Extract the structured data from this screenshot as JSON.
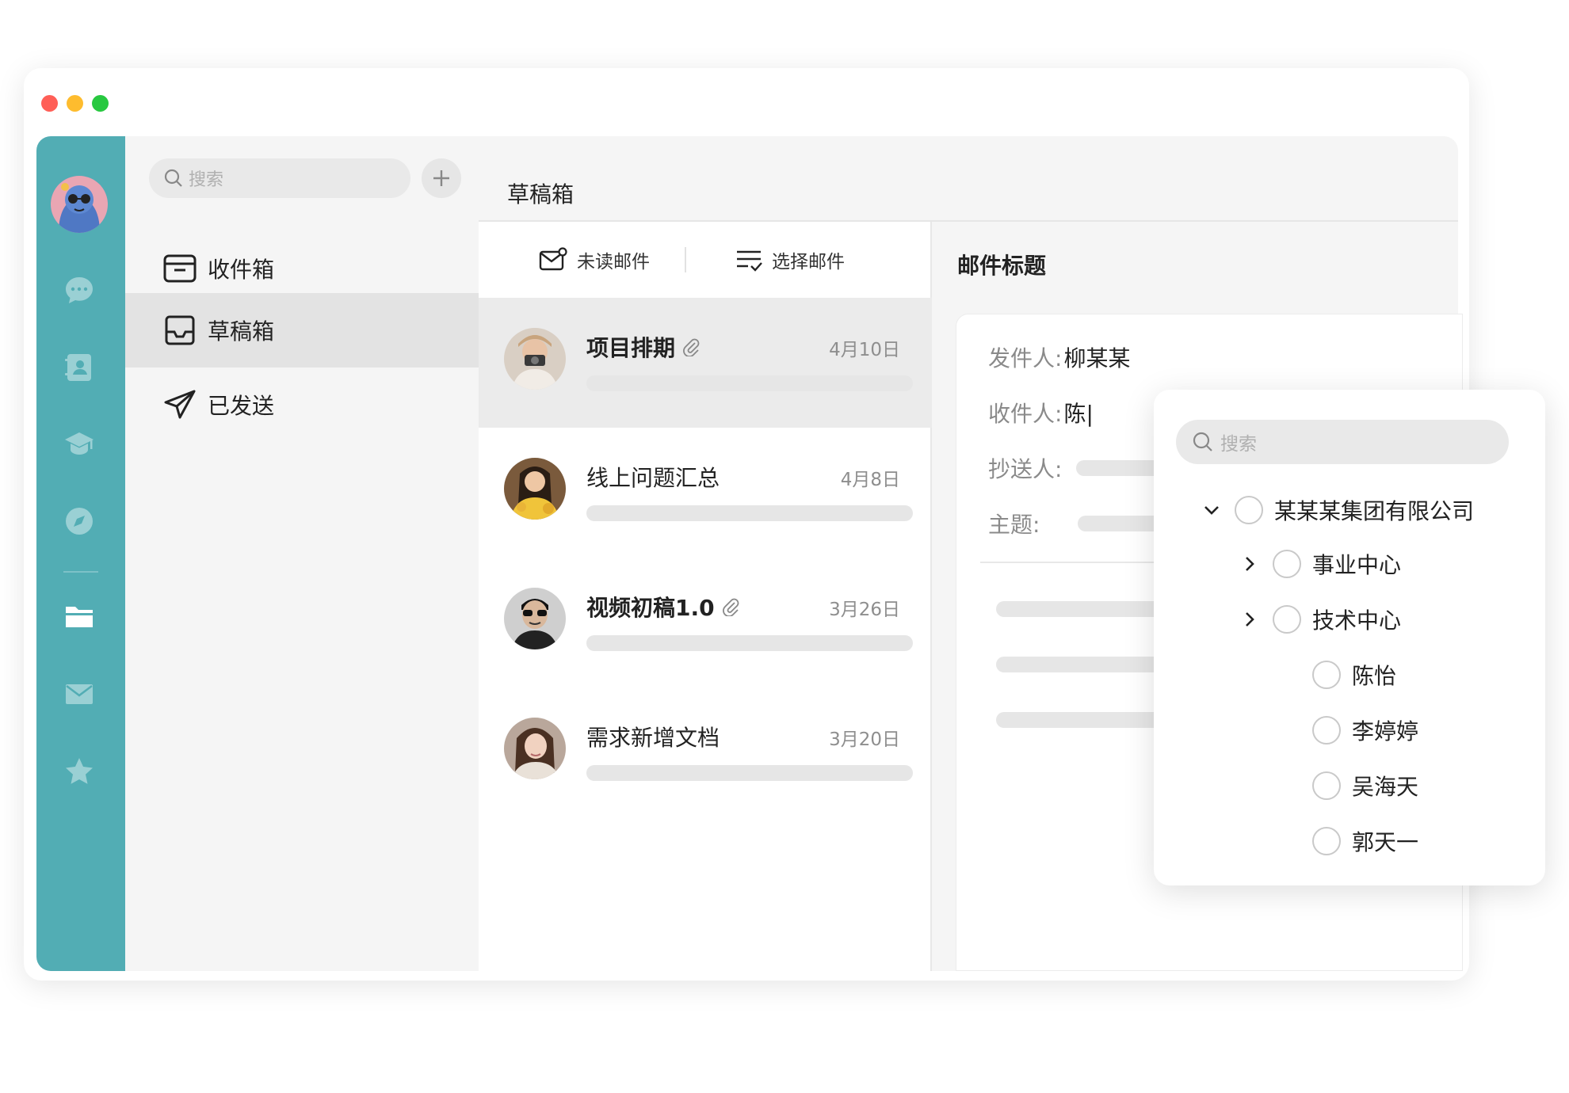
{
  "window": {
    "traffic_lights": [
      "close",
      "minimize",
      "maximize"
    ]
  },
  "rail": {
    "accent": "#52adb4",
    "icons": [
      "chat-icon",
      "contacts-icon",
      "graduation-cap-icon",
      "compass-icon",
      "folder-icon",
      "mail-icon",
      "star-icon"
    ]
  },
  "folders": {
    "search_placeholder": "搜索",
    "items": [
      {
        "label": "收件箱",
        "icon": "inbox-icon"
      },
      {
        "label": "草稿箱",
        "icon": "drafts-icon",
        "active": true
      },
      {
        "label": "已发送",
        "icon": "send-icon"
      }
    ]
  },
  "main": {
    "title": "草稿箱"
  },
  "list": {
    "toolbar": {
      "unread_label": "未读邮件",
      "select_label": "选择邮件"
    },
    "mails": [
      {
        "subject": "项目排期",
        "date": "4月10日",
        "attachment": true,
        "selected": true,
        "bold": true
      },
      {
        "subject": "线上问题汇总",
        "date": "4月8日",
        "attachment": false,
        "selected": false,
        "bold": false
      },
      {
        "subject": "视频初稿1.0",
        "date": "3月26日",
        "attachment": true,
        "selected": false,
        "bold": true
      },
      {
        "subject": "需求新增文档",
        "date": "3月20日",
        "attachment": false,
        "selected": false,
        "bold": false
      }
    ]
  },
  "detail": {
    "title": "邮件标题",
    "sender_label": "发件人:",
    "sender_value": "柳某某",
    "recipient_label": "收件人:",
    "recipient_value": "陈|",
    "cc_label": "抄送人:",
    "subject_label": "主题:"
  },
  "picker": {
    "search_placeholder": "搜索",
    "tree": [
      {
        "label": "某某某集团有限公司",
        "expand": "down"
      },
      {
        "label": "事业中心",
        "expand": "right"
      },
      {
        "label": "技术中心",
        "expand": "right"
      },
      {
        "label": "陈怡"
      },
      {
        "label": "李婷婷"
      },
      {
        "label": "吴海天"
      },
      {
        "label": "郭天一"
      }
    ]
  }
}
